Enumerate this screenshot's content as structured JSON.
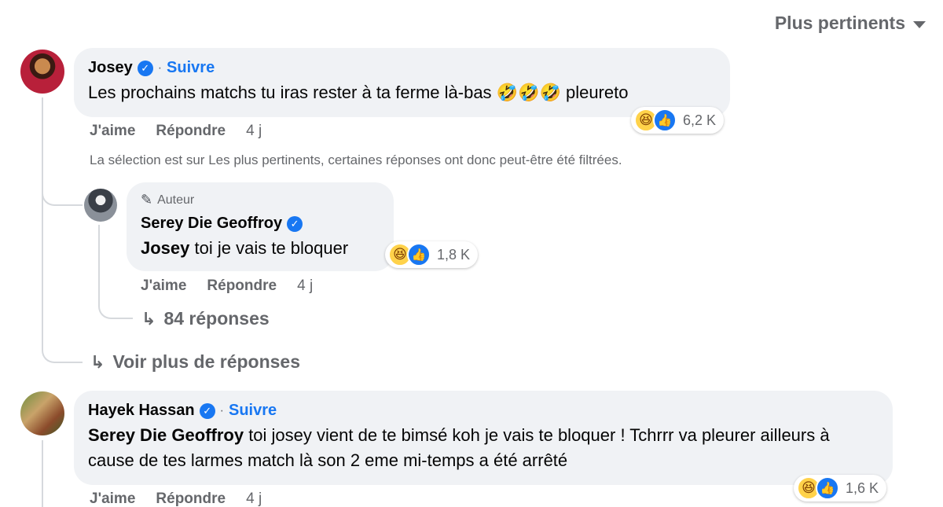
{
  "sort": {
    "label": "Plus pertinents",
    "icon": "caret-down-icon"
  },
  "comments": [
    {
      "author": "Josey",
      "verified": true,
      "follow_label": "Suivre",
      "text": "Les prochains matchs tu iras rester à ta ferme là-bas 🤣🤣🤣 pleureto",
      "reactions": {
        "icons": [
          "haha-icon",
          "like-icon"
        ],
        "count": "6,2 K"
      },
      "actions": {
        "like": "J'aime",
        "reply": "Répondre",
        "time": "4 j"
      },
      "filter_note": "La sélection est sur Les plus pertinents, certaines réponses ont donc peut-être été filtrées.",
      "reply": {
        "badge": "Auteur",
        "author": "Serey Die Geoffroy",
        "verified": true,
        "mention": "Josey",
        "text": " toi je vais te bloquer",
        "reactions": {
          "icons": [
            "haha-icon",
            "like-icon"
          ],
          "count": "1,8 K"
        },
        "actions": {
          "like": "J'aime",
          "reply": "Répondre",
          "time": "4 j"
        },
        "more_replies": "84 réponses"
      },
      "more_label": "Voir plus de réponses"
    },
    {
      "author": "Hayek Hassan",
      "verified": true,
      "follow_label": "Suivre",
      "mention": "Serey Die Geoffroy",
      "text": " toi josey vient de te bimsé koh je vais te bloquer ! Tchrrr va pleurer ailleurs à cause de tes larmes match là son 2 eme mi-temps a été arrêté",
      "reactions": {
        "icons": [
          "haha-icon",
          "like-icon"
        ],
        "count": "1,6 K"
      },
      "actions": {
        "like": "J'aime",
        "reply": "Répondre",
        "time": "4 j"
      }
    }
  ],
  "separator": "·",
  "reply_arrow": "↳",
  "colors": {
    "link": "#1877f2",
    "bubble": "#f0f2f5",
    "muted": "#65676b",
    "haha": "#ffd24a"
  }
}
